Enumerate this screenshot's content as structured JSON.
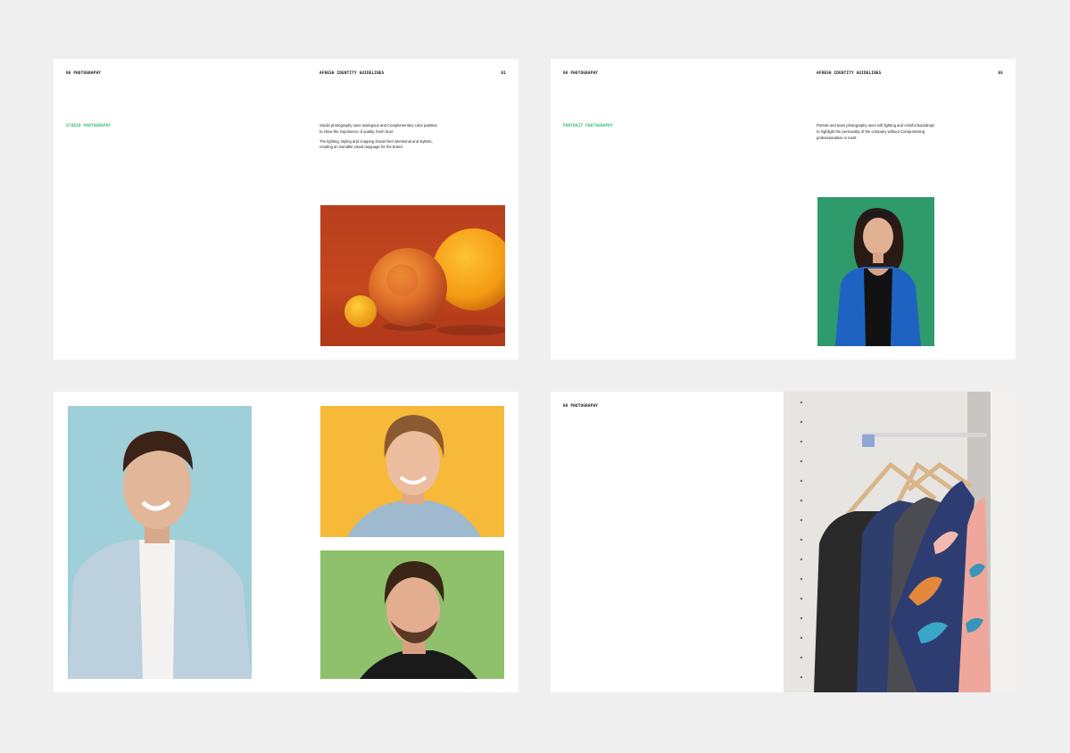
{
  "spreads": [
    {
      "header_left": "06 PHOTOGRAPHY",
      "header_center": "AFRESH IDENTITY GUIDELINES",
      "header_right": "01",
      "section_title": "STUDIO PHOTOGRAPHY",
      "paragraphs": [
        "Studio photography uses analogous and Complementary color palettes to show the importance of quality, fresh food.",
        "The lighting, styling and cropping should feel intentional and stylistic, creating an ownable visual language for the brand."
      ],
      "photo": "citrus-fruit-still-life"
    },
    {
      "header_left": "06 PHOTOGRAPHY",
      "header_center": "AFRESH IDENTITY GUIDELINES",
      "header_right": "05",
      "section_title": "PORTRAIT PHOTOGRAPHY",
      "paragraphs": [
        "Portrait and team photography uses soft lighting and colorful backdrops to highlight the personality of the company without Compromising professionalism or merit."
      ],
      "photo": "woman-portrait-green-backdrop"
    },
    {
      "photos": [
        "man-portrait-blue-backdrop",
        "man-portrait-yellow-backdrop",
        "man-portrait-green-backdrop"
      ]
    },
    {
      "header_left": "06 PHOTOGRAPHY",
      "photo": "shirts-on-hangers-rack"
    }
  ],
  "colors": {
    "background": "#efefef",
    "page": "#ffffff",
    "accent_green": "#2fb872"
  }
}
